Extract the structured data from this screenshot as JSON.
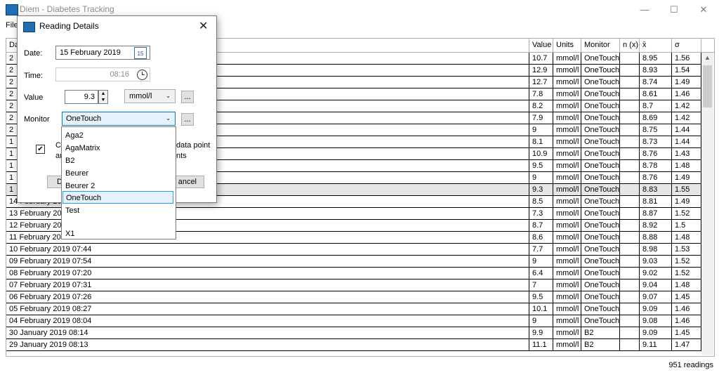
{
  "app": {
    "title": "Diem - Diabetes Tracking",
    "minimize": "—",
    "maximize": "☐",
    "close": "✕"
  },
  "menu": {
    "file": "File"
  },
  "table": {
    "columns": [
      "Date",
      "Value",
      "Units",
      "Monitor",
      "n (x)",
      "x̄",
      "σ"
    ],
    "rows": [
      {
        "date": "2",
        "value": "10.7",
        "units": "mmol/l",
        "monitor": "OneTouch",
        "n": "",
        "mean": "8.95",
        "sd": "1.56"
      },
      {
        "date": "2",
        "value": "12.9",
        "units": "mmol/l",
        "monitor": "OneTouch",
        "n": "",
        "mean": "8.93",
        "sd": "1.54"
      },
      {
        "date": "2",
        "value": "12.7",
        "units": "mmol/l",
        "monitor": "OneTouch",
        "n": "",
        "mean": "8.74",
        "sd": "1.49"
      },
      {
        "date": "2",
        "value": "7.8",
        "units": "mmol/l",
        "monitor": "OneTouch",
        "n": "",
        "mean": "8.61",
        "sd": "1.46"
      },
      {
        "date": "2",
        "value": "8.2",
        "units": "mmol/l",
        "monitor": "OneTouch",
        "n": "",
        "mean": "8.7",
        "sd": "1.42"
      },
      {
        "date": "2",
        "value": "7.9",
        "units": "mmol/l",
        "monitor": "OneTouch",
        "n": "",
        "mean": "8.69",
        "sd": "1.42"
      },
      {
        "date": "2",
        "value": "9",
        "units": "mmol/l",
        "monitor": "OneTouch",
        "n": "",
        "mean": "8.75",
        "sd": "1.44"
      },
      {
        "date": "1",
        "value": "8.1",
        "units": "mmol/l",
        "monitor": "OneTouch",
        "n": "",
        "mean": "8.73",
        "sd": "1.44"
      },
      {
        "date": "1",
        "value": "10.9",
        "units": "mmol/l",
        "monitor": "OneTouch",
        "n": "",
        "mean": "8.76",
        "sd": "1.43"
      },
      {
        "date": "1",
        "value": "9.5",
        "units": "mmol/l",
        "monitor": "OneTouch",
        "n": "",
        "mean": "8.78",
        "sd": "1.48"
      },
      {
        "date": "1",
        "value": "9",
        "units": "mmol/l",
        "monitor": "OneTouch",
        "n": "",
        "mean": "8.76",
        "sd": "1.49"
      },
      {
        "date": "1",
        "value": "9.3",
        "units": "mmol/l",
        "monitor": "OneTouch",
        "n": "",
        "mean": "8.83",
        "sd": "1.55",
        "selected": true
      },
      {
        "date": "14 February 20",
        "value": "8.5",
        "units": "mmol/l",
        "monitor": "OneTouch",
        "n": "",
        "mean": "8.81",
        "sd": "1.49"
      },
      {
        "date": "13 February 20",
        "value": "7.3",
        "units": "mmol/l",
        "monitor": "OneTouch",
        "n": "",
        "mean": "8.87",
        "sd": "1.52"
      },
      {
        "date": "12 February 20",
        "value": "8.7",
        "units": "mmol/l",
        "monitor": "OneTouch",
        "n": "",
        "mean": "8.92",
        "sd": "1.5"
      },
      {
        "date": "11 February 2019 07:30",
        "value": "8.6",
        "units": "mmol/l",
        "monitor": "OneTouch",
        "n": "",
        "mean": "8.88",
        "sd": "1.48"
      },
      {
        "date": "10 February 2019 07:44",
        "value": "7.7",
        "units": "mmol/l",
        "monitor": "OneTouch",
        "n": "",
        "mean": "8.98",
        "sd": "1.53"
      },
      {
        "date": "09 February 2019 07:54",
        "value": "9",
        "units": "mmol/l",
        "monitor": "OneTouch",
        "n": "",
        "mean": "9.03",
        "sd": "1.52"
      },
      {
        "date": "08 February 2019 07:20",
        "value": "6.4",
        "units": "mmol/l",
        "monitor": "OneTouch",
        "n": "",
        "mean": "9.02",
        "sd": "1.52"
      },
      {
        "date": "07 February 2019 07:31",
        "value": "7",
        "units": "mmol/l",
        "monitor": "OneTouch",
        "n": "",
        "mean": "9.04",
        "sd": "1.48"
      },
      {
        "date": "06 February 2019 07:26",
        "value": "9.5",
        "units": "mmol/l",
        "monitor": "OneTouch",
        "n": "",
        "mean": "9.07",
        "sd": "1.45"
      },
      {
        "date": "05 February 2019 08:27",
        "value": "10.1",
        "units": "mmol/l",
        "monitor": "OneTouch",
        "n": "",
        "mean": "9.09",
        "sd": "1.46"
      },
      {
        "date": "04 February 2019 08:04",
        "value": "9",
        "units": "mmol/l",
        "monitor": "OneTouch",
        "n": "",
        "mean": "9.08",
        "sd": "1.46"
      },
      {
        "date": "30 January 2019 08:14",
        "value": "9.9",
        "units": "mmol/l",
        "monitor": "B2",
        "n": "",
        "mean": "9.09",
        "sd": "1.45"
      },
      {
        "date": "29 January 2019 08:13",
        "value": "11.1",
        "units": "mmol/l",
        "monitor": "B2",
        "n": "",
        "mean": "9.11",
        "sd": "1.47"
      }
    ]
  },
  "status": {
    "count": "951 readings"
  },
  "dialog": {
    "title": "Reading Details",
    "close": "✕",
    "date_label": "Date:",
    "date_value": "15 February 2019",
    "calendar_day": "15",
    "time_label": "Time:",
    "time_value": "08:16",
    "value_label": "Value",
    "value": "9.3",
    "units_value": "mmol/l",
    "monitor_label": "Monitor",
    "monitor_value": "OneTouch",
    "ellipsis": "...",
    "checkbox_text_left": "Ca",
    "checkbox_text_left2": "ar",
    "checkbox_text_right": "data point",
    "checkbox_text_right2": "nts",
    "ok_partial": "D",
    "cancel_partial": "ancel"
  },
  "dropdown": {
    "options": [
      "Aga2",
      "AgaMatrix",
      "B2",
      "Beurer",
      "Beurer 2",
      "OneTouch",
      "Test",
      "",
      "X1"
    ],
    "selected_index": 5
  }
}
